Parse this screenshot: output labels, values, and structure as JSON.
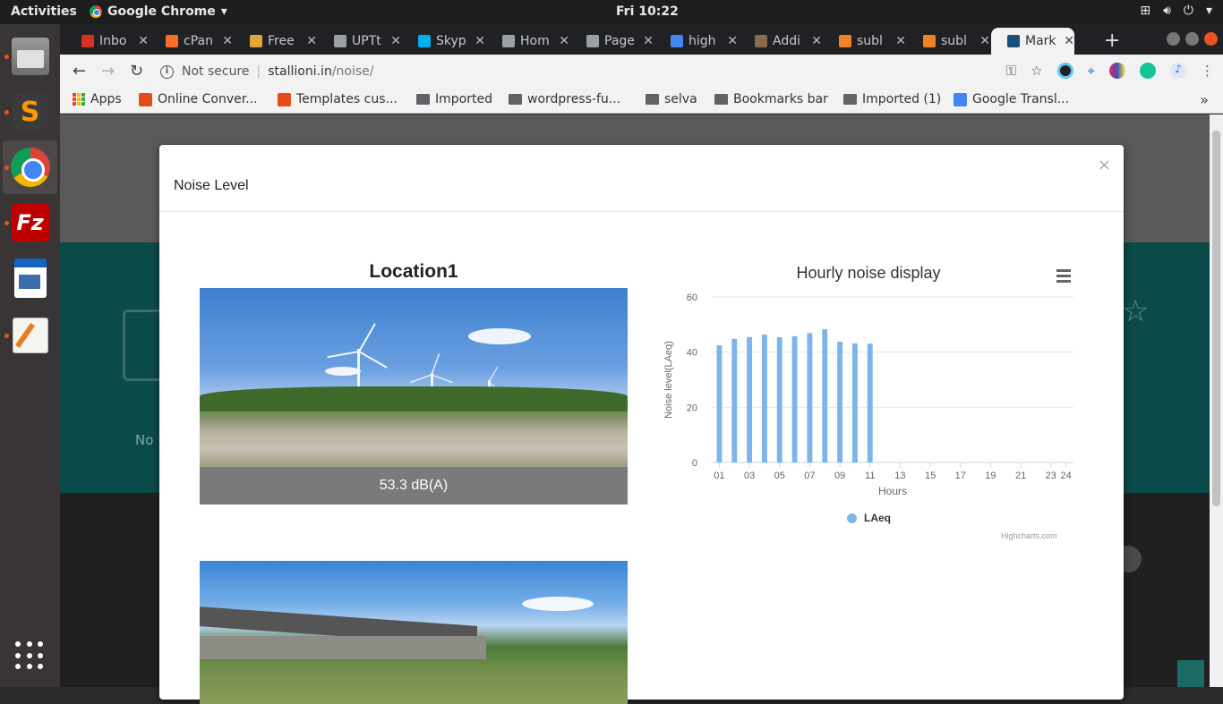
{
  "topbar": {
    "activities": "Activities",
    "app_name": "Google Chrome",
    "clock": "Fri 10:22"
  },
  "tabs": [
    {
      "label": "Inbo",
      "color": "#d93025"
    },
    {
      "label": "cPan",
      "color": "#ff6c2c"
    },
    {
      "label": "Free",
      "color": "#e0a53a"
    },
    {
      "label": "UPTt",
      "color": "#9aa0a6"
    },
    {
      "label": "Skyp",
      "color": "#00aff0"
    },
    {
      "label": "Hom",
      "color": "#9aa0a6"
    },
    {
      "label": "Page",
      "color": "#9aa0a6"
    },
    {
      "label": "high",
      "color": "#4285f4"
    },
    {
      "label": "Addi",
      "color": "#8a6a4a"
    },
    {
      "label": "subl",
      "color": "#f48024"
    },
    {
      "label": "subl",
      "color": "#f48024"
    },
    {
      "label": "Mark",
      "color": "#1a4f7a"
    }
  ],
  "address": {
    "security": "Not secure",
    "host": "stallioni.in",
    "path": "/noise/"
  },
  "bookmarks": [
    {
      "label": "Apps",
      "icon": "apps-icon"
    },
    {
      "label": "Online Conver...",
      "icon": "converter-icon"
    },
    {
      "label": "Templates cus...",
      "icon": "magento-icon"
    },
    {
      "label": "Imported",
      "icon": "folder-icon"
    },
    {
      "label": "wordpress-fu...",
      "icon": "folder-icon"
    },
    {
      "label": "selva",
      "icon": "folder-icon"
    },
    {
      "label": "Bookmarks bar",
      "icon": "folder-icon"
    },
    {
      "label": "Imported (1)",
      "icon": "folder-icon"
    },
    {
      "label": "Google Transl...",
      "icon": "translate-icon"
    }
  ],
  "page": {
    "background_text": "No"
  },
  "modal": {
    "title": "Noise Level",
    "close": "×",
    "location_title": "Location1",
    "reading": "53.3 dB(A)"
  },
  "chart_data": {
    "type": "bar",
    "title": "Hourly noise display",
    "xlabel": "Hours",
    "ylabel": "Noise level(LAeq)",
    "ylim": [
      0,
      60
    ],
    "y_ticks": [
      0,
      20,
      40,
      60
    ],
    "categories": [
      "01",
      "02",
      "03",
      "04",
      "05",
      "06",
      "07",
      "08",
      "09",
      "10",
      "11",
      "12",
      "13",
      "14",
      "15",
      "16",
      "17",
      "18",
      "19",
      "20",
      "21",
      "22",
      "23",
      "24"
    ],
    "x_tick_labels": [
      "01",
      "03",
      "05",
      "07",
      "09",
      "11",
      "13",
      "15",
      "17",
      "19",
      "21",
      "23",
      "24"
    ],
    "series": [
      {
        "name": "LAeq",
        "color": "#7cb5ec",
        "values": [
          42.5,
          44.8,
          45.5,
          46.4,
          45.4,
          45.8,
          46.9,
          48.3,
          43.8,
          43.2,
          43.1,
          null,
          null,
          null,
          null,
          null,
          null,
          null,
          null,
          null,
          null,
          null,
          null,
          null
        ]
      }
    ],
    "legend_position": "bottom-center",
    "grid": true,
    "credits": "Highcharts.com"
  }
}
